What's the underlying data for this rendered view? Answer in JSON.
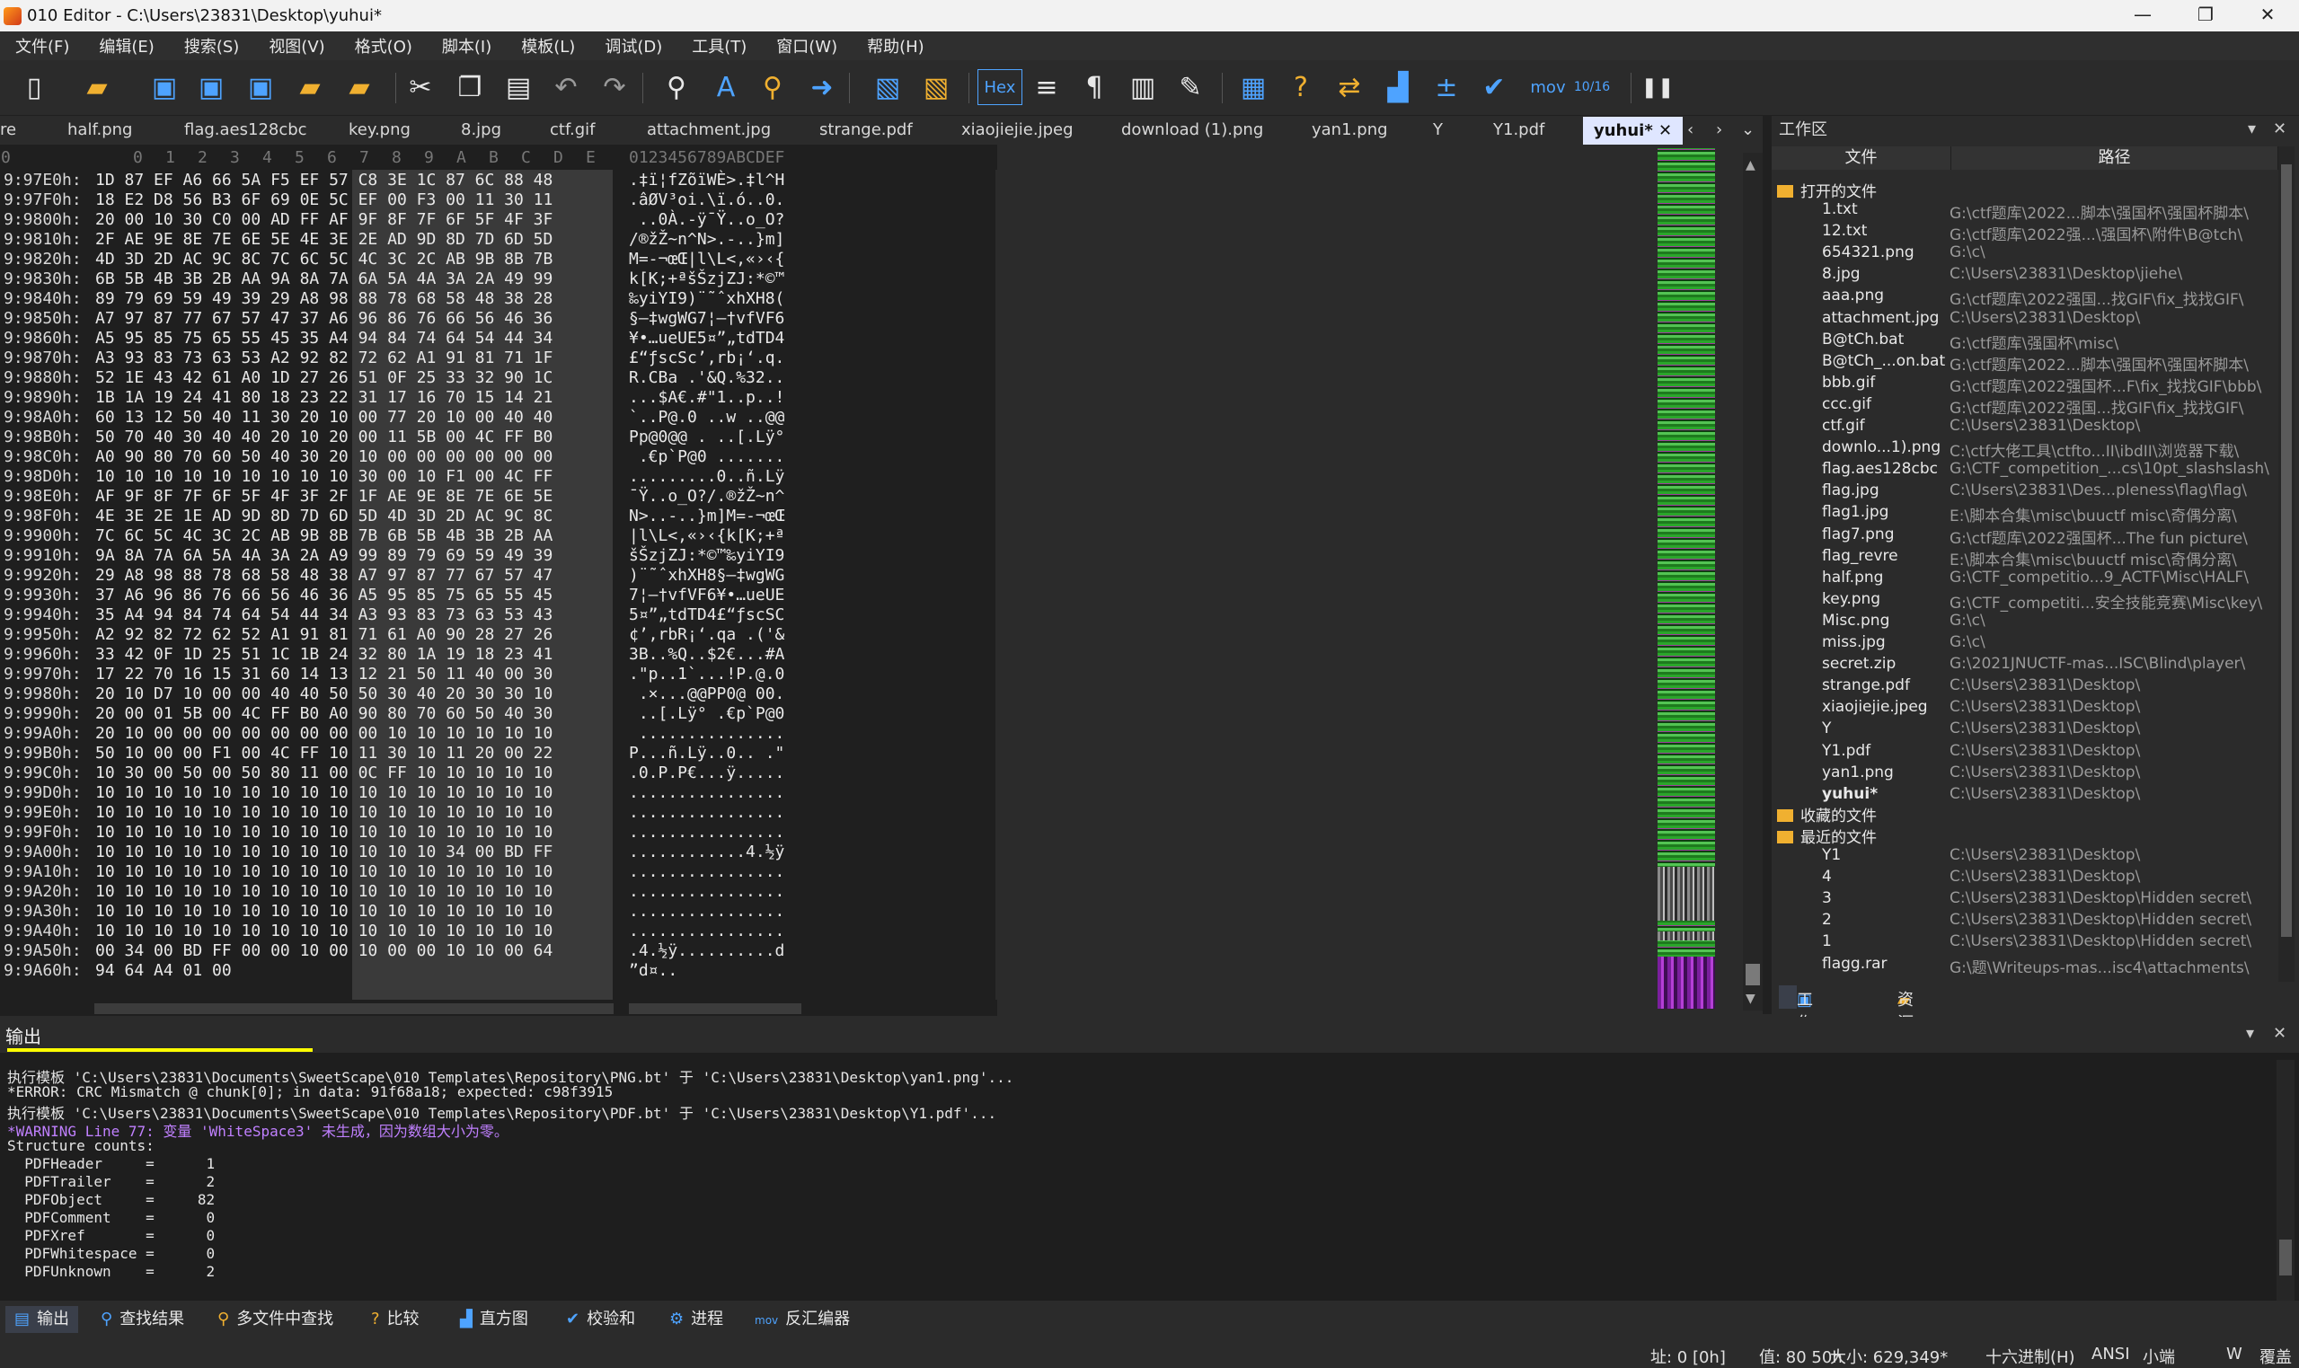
{
  "window": {
    "title": "010 Editor - C:\\Users\\23831\\Desktop\\yuhui*",
    "minimize": "—",
    "maximize": "❐",
    "close": "✕"
  },
  "menu": [
    "文件(F)",
    "编辑(E)",
    "搜索(S)",
    "视图(V)",
    "格式(O)",
    "脚本(I)",
    "模板(L)",
    "调试(D)",
    "工具(T)",
    "窗口(W)",
    "帮助(H)"
  ],
  "toolbar": {
    "hex_label": "Hex",
    "mov_label": "mov",
    "num_label": "10/16"
  },
  "tabs": [
    "re",
    "half.png",
    "flag.aes128cbc",
    "key.png",
    "8.jpg",
    "ctf.gif",
    "attachment.jpg",
    "strange.pdf",
    "xiaojiejie.jpeg",
    "download (1).png",
    "yan1.png",
    "Y",
    "Y1.pdf"
  ],
  "active_tab": "yuhui*",
  "hex_header": {
    "columns": [
      "0",
      "1",
      "2",
      "3",
      "4",
      "5",
      "6",
      "7",
      "8",
      "9",
      "A",
      "B",
      "C",
      "D",
      "E",
      "F"
    ],
    "text_header": "0123456789ABCDEF"
  },
  "hex_rows": [
    {
      "addr": "9:97E0h:",
      "bytes": "1D 87 EF A6 66 5A F5 EF 57 C8 3E 1C 87 6C 88 48",
      "text": ".‡ï¦fZõïWÈ>.‡l^H"
    },
    {
      "addr": "9:97F0h:",
      "bytes": "18 E2 D8 56 B3 6F 69 0E 5C EF 00 F3 00 11 30 11",
      "text": ".âØV³oi.\\ï.ó..0."
    },
    {
      "addr": "9:9800h:",
      "bytes": "20 00 10 30 C0 00 AD FF AF 9F 8F 7F 6F 5F 4F 3F",
      "text": " ..0À.-ÿ¯Ÿ..o_O?"
    },
    {
      "addr": "9:9810h:",
      "bytes": "2F AE 9E 8E 7E 6E 5E 4E 3E 2E AD 9D 8D 7D 6D 5D",
      "text": "/®žŽ~n^N>.-..}m]"
    },
    {
      "addr": "9:9820h:",
      "bytes": "4D 3D 2D AC 9C 8C 7C 6C 5C 4C 3C 2C AB 9B 8B 7B",
      "text": "M=-¬œŒ|l\\L<,«›‹{"
    },
    {
      "addr": "9:9830h:",
      "bytes": "6B 5B 4B 3B 2B AA 9A 8A 7A 6A 5A 4A 3A 2A 49 99",
      "text": "k[K;+ªšŠzjZJ:*©™"
    },
    {
      "addr": "9:9840h:",
      "bytes": "89 79 69 59 49 39 29 A8 98 88 78 68 58 48 38 28",
      "text": "‰yiYI9)¨˜ˆxhXH8("
    },
    {
      "addr": "9:9850h:",
      "bytes": "A7 97 87 77 67 57 47 37 A6 96 86 76 66 56 46 36",
      "text": "§—‡wgWG7¦–†vfVF6"
    },
    {
      "addr": "9:9860h:",
      "bytes": "A5 95 85 75 65 55 45 35 A4 94 84 74 64 54 44 34",
      "text": "¥•…ueUE5¤”„tdTD4"
    },
    {
      "addr": "9:9870h:",
      "bytes": "A3 93 83 73 63 53 A2 92 82 72 62 A1 91 81 71 1F",
      "text": "£“ƒscSc’‚rb¡‘.q."
    },
    {
      "addr": "9:9880h:",
      "bytes": "52 1E 43 42 61 A0 1D 27 26 51 0F 25 33 32 90 1C",
      "text": "R.CBa .'&Q.%32.."
    },
    {
      "addr": "9:9890h:",
      "bytes": "1B 1A 19 24 41 80 18 23 22 31 17 16 70 15 14 21",
      "text": "...$A€.#\"1..p..!"
    },
    {
      "addr": "9:98A0h:",
      "bytes": "60 13 12 50 40 11 30 20 10 00 77 20 10 00 40 40",
      "text": "`..P@.0 ..w ..@@"
    },
    {
      "addr": "9:98B0h:",
      "bytes": "50 70 40 30 40 40 20 10 20 00 11 5B 00 4C FF B0",
      "text": "Pp@0@@ . ..[.Lÿ°"
    },
    {
      "addr": "9:98C0h:",
      "bytes": "A0 90 80 70 60 50 40 30 20 10 00 00 00 00 00 00",
      "text": " .€p`P@0 ......."
    },
    {
      "addr": "9:98D0h:",
      "bytes": "10 10 10 10 10 10 10 10 10 30 00 10 F1 00 4C FF",
      "text": ".........0..ñ.Lÿ"
    },
    {
      "addr": "9:98E0h:",
      "bytes": "AF 9F 8F 7F 6F 5F 4F 3F 2F 1F AE 9E 8E 7E 6E 5E",
      "text": "¯Ÿ..o_O?/.®žŽ~n^"
    },
    {
      "addr": "9:98F0h:",
      "bytes": "4E 3E 2E 1E AD 9D 8D 7D 6D 5D 4D 3D 2D AC 9C 8C",
      "text": "N>..-..}m]M=-¬œŒ"
    },
    {
      "addr": "9:9900h:",
      "bytes": "7C 6C 5C 4C 3C 2C AB 9B 8B 7B 6B 5B 4B 3B 2B AA",
      "text": "|l\\L<,«›‹{k[K;+ª"
    },
    {
      "addr": "9:9910h:",
      "bytes": "9A 8A 7A 6A 5A 4A 3A 2A A9 99 89 79 69 59 49 39",
      "text": "šŠzjZJ:*©™‰yiYI9"
    },
    {
      "addr": "9:9920h:",
      "bytes": "29 A8 98 88 78 68 58 48 38 A7 97 87 77 67 57 47",
      "text": ")¨˜ˆxhXH8§—‡wgWG"
    },
    {
      "addr": "9:9930h:",
      "bytes": "37 A6 96 86 76 66 56 46 36 A5 95 85 75 65 55 45",
      "text": "7¦–†vfVF6¥•…ueUE"
    },
    {
      "addr": "9:9940h:",
      "bytes": "35 A4 94 84 74 64 54 44 34 A3 93 83 73 63 53 43",
      "text": "5¤”„tdTD4£“ƒscSC"
    },
    {
      "addr": "9:9950h:",
      "bytes": "A2 92 82 72 62 52 A1 91 81 71 61 A0 90 28 27 26",
      "text": "¢’‚rbR¡‘.qa .('&"
    },
    {
      "addr": "9:9960h:",
      "bytes": "33 42 0F 1D 25 51 1C 1B 24 32 80 1A 19 18 23 41",
      "text": "3B..%Q..$2€...#A"
    },
    {
      "addr": "9:9970h:",
      "bytes": "17 22 70 16 15 31 60 14 13 12 21 50 11 40 00 30",
      "text": ".\"p..1`...!P.@.0"
    },
    {
      "addr": "9:9980h:",
      "bytes": "20 10 D7 10 00 00 40 40 50 50 30 40 20 30 30 10",
      "text": " .×...@@PP0@ 00."
    },
    {
      "addr": "9:9990h:",
      "bytes": "20 00 01 5B 00 4C FF B0 A0 90 80 70 60 50 40 30",
      "text": " ..[.Lÿ° .€p`P@0"
    },
    {
      "addr": "9:99A0h:",
      "bytes": "20 10 00 00 00 00 00 00 00 00 10 10 10 10 10 10",
      "text": " ..............."
    },
    {
      "addr": "9:99B0h:",
      "bytes": "50 10 00 00 F1 00 4C FF 10 11 30 10 11 20 00 22",
      "text": "P...ñ.Lÿ..0.. .\""
    },
    {
      "addr": "9:99C0h:",
      "bytes": "10 30 00 50 00 50 80 11 00 0C FF 10 10 10 10 10",
      "text": ".0.P.P€...ÿ....."
    },
    {
      "addr": "9:99D0h:",
      "bytes": "10 10 10 10 10 10 10 10 10 10 10 10 10 10 10 10",
      "text": "................"
    },
    {
      "addr": "9:99E0h:",
      "bytes": "10 10 10 10 10 10 10 10 10 10 10 10 10 10 10 10",
      "text": "................"
    },
    {
      "addr": "9:99F0h:",
      "bytes": "10 10 10 10 10 10 10 10 10 10 10 10 10 10 10 10",
      "text": "................"
    },
    {
      "addr": "9:9A00h:",
      "bytes": "10 10 10 10 10 10 10 10 10 10 10 10 34 00 BD FF",
      "text": "............4.½ÿ"
    },
    {
      "addr": "9:9A10h:",
      "bytes": "10 10 10 10 10 10 10 10 10 10 10 10 10 10 10 10",
      "text": "................"
    },
    {
      "addr": "9:9A20h:",
      "bytes": "10 10 10 10 10 10 10 10 10 10 10 10 10 10 10 10",
      "text": "................"
    },
    {
      "addr": "9:9A30h:",
      "bytes": "10 10 10 10 10 10 10 10 10 10 10 10 10 10 10 10",
      "text": "................"
    },
    {
      "addr": "9:9A40h:",
      "bytes": "10 10 10 10 10 10 10 10 10 10 10 10 10 10 10 10",
      "text": "................"
    },
    {
      "addr": "9:9A50h:",
      "bytes": "00 34 00 BD FF 00 00 10 00 10 00 00 10 10 00 64",
      "text": ".4.½ÿ..........d"
    },
    {
      "addr": "9:9A60h:",
      "bytes": "94 64 A4 01 00",
      "text": "”d¤.."
    }
  ],
  "workspace": {
    "title": "工作区",
    "col_file": "文件",
    "col_path": "路径",
    "open_group": "打开的文件",
    "open_files": [
      {
        "name": "1.txt",
        "path": "G:\\ctf题库\\2022...脚本\\强国杯\\强国杯脚本\\"
      },
      {
        "name": "12.txt",
        "path": "G:\\ctf题库\\2022强...\\强国杯\\附件\\B@tch\\"
      },
      {
        "name": "654321.png",
        "path": "G:\\c\\"
      },
      {
        "name": "8.jpg",
        "path": "C:\\Users\\23831\\Desktop\\jiehe\\"
      },
      {
        "name": "aaa.png",
        "path": "G:\\ctf题库\\2022强国...找GIF\\fix_找找GIF\\"
      },
      {
        "name": "attachment.jpg",
        "path": "C:\\Users\\23831\\Desktop\\"
      },
      {
        "name": "B@tCh.bat",
        "path": "G:\\ctf题库\\强国杯\\misc\\"
      },
      {
        "name": "B@tCh_...on.bat",
        "path": "G:\\ctf题库\\2022...脚本\\强国杯\\强国杯脚本\\"
      },
      {
        "name": "bbb.gif",
        "path": "G:\\ctf题库\\2022强国杯...F\\fix_找找GIF\\bbb\\"
      },
      {
        "name": "ccc.gif",
        "path": "G:\\ctf题库\\2022强国...找GIF\\fix_找找GIF\\"
      },
      {
        "name": "ctf.gif",
        "path": "C:\\Users\\23831\\Desktop\\"
      },
      {
        "name": "downlo...1).png",
        "path": "C:\\ctf大佬工具\\ctfto...II\\ibdII\\浏览器下载\\"
      },
      {
        "name": "flag.aes128cbc",
        "path": "G:\\CTF_competition_...cs\\10pt_slashslash\\"
      },
      {
        "name": "flag.jpg",
        "path": "C:\\Users\\23831\\Des...pleness\\flag\\flag\\"
      },
      {
        "name": "flag1.jpg",
        "path": "E:\\脚本合集\\misc\\buuctf misc\\奇偶分离\\"
      },
      {
        "name": "flag7.png",
        "path": "G:\\ctf题库\\2022强国杯...The fun picture\\"
      },
      {
        "name": "flag_revre",
        "path": "E:\\脚本合集\\misc\\buuctf misc\\奇偶分离\\"
      },
      {
        "name": "half.png",
        "path": "G:\\CTF_competitio...9_ACTF\\Misc\\HALF\\"
      },
      {
        "name": "key.png",
        "path": "G:\\CTF_competiti...安全技能竞赛\\Misc\\key\\"
      },
      {
        "name": "Misc.png",
        "path": "G:\\c\\"
      },
      {
        "name": "miss.jpg",
        "path": "G:\\c\\"
      },
      {
        "name": "secret.zip",
        "path": "G:\\2021JNUCTF-mas...ISC\\Blind\\player\\"
      },
      {
        "name": "strange.pdf",
        "path": "C:\\Users\\23831\\Desktop\\"
      },
      {
        "name": "xiaojiejie.jpeg",
        "path": "C:\\Users\\23831\\Desktop\\"
      },
      {
        "name": "Y",
        "path": "C:\\Users\\23831\\Desktop\\"
      },
      {
        "name": "Y1.pdf",
        "path": "C:\\Users\\23831\\Desktop\\"
      },
      {
        "name": "yan1.png",
        "path": "C:\\Users\\23831\\Desktop\\"
      },
      {
        "name": "yuhui*",
        "path": "C:\\Users\\23831\\Desktop\\"
      }
    ],
    "fav_group": "收藏的文件",
    "recent_group": "最近的文件",
    "recent_files": [
      {
        "name": "Y1",
        "path": "C:\\Users\\23831\\Desktop\\"
      },
      {
        "name": "4",
        "path": "C:\\Users\\23831\\Desktop\\"
      },
      {
        "name": "3",
        "path": "C:\\Users\\23831\\Desktop\\Hidden secret\\"
      },
      {
        "name": "2",
        "path": "C:\\Users\\23831\\Desktop\\Hidden secret\\"
      },
      {
        "name": "1",
        "path": "C:\\Users\\23831\\Desktop\\Hidden secret\\"
      },
      {
        "name": "flagg.rar",
        "path": "G:\\题\\Writeups-mas...isc4\\attachments\\"
      }
    ],
    "tab_workspace": "工作区",
    "tab_explorer": "资源管理器"
  },
  "output": {
    "title": "输出",
    "lines": [
      {
        "text": "执行模板 'C:\\Users\\23831\\Documents\\SweetScape\\010 Templates\\Repository\\PNG.bt' 于 'C:\\Users\\23831\\Desktop\\yan1.png'...",
        "warn": false
      },
      {
        "text": "*ERROR: CRC Mismatch @ chunk[0]; in data: 91f68a18; expected: c98f3915",
        "warn": false
      },
      {
        "text": "执行模板 'C:\\Users\\23831\\Documents\\SweetScape\\010 Templates\\Repository\\PDF.bt' 于 'C:\\Users\\23831\\Desktop\\Y1.pdf'...",
        "warn": false
      },
      {
        "text": "*WARNING Line 77: 变量 'WhiteSpace3' 未生成，因为数组大小为零。",
        "warn": true
      },
      {
        "text": "Structure counts:",
        "warn": false
      },
      {
        "text": "  PDFHeader     =      1",
        "warn": false
      },
      {
        "text": "  PDFTrailer    =      2",
        "warn": false
      },
      {
        "text": "  PDFObject     =     82",
        "warn": false
      },
      {
        "text": "  PDFComment    =      0",
        "warn": false
      },
      {
        "text": "  PDFXref       =      0",
        "warn": false
      },
      {
        "text": "  PDFWhitespace =      0",
        "warn": false
      },
      {
        "text": "  PDFUnknown    =      2",
        "warn": false
      }
    ]
  },
  "bottom_tabs": [
    "输出",
    "查找结果",
    "多文件中查找",
    "比较",
    "直方图",
    "校验和",
    "进程",
    "反汇编器"
  ],
  "status": {
    "addr": "址: 0 [0h]",
    "value": "值: 80 50h",
    "size": "大小: 629,349*",
    "mode": "十六进制(H)",
    "encoding": "ANSI",
    "endian": "小端",
    "w": "W",
    "overwrite": "覆盖"
  },
  "colors": {
    "accent": "#4ea3ff",
    "active_tab": "#dfe6ff",
    "warning": "#c080ff",
    "highlight": "#ffff00"
  }
}
